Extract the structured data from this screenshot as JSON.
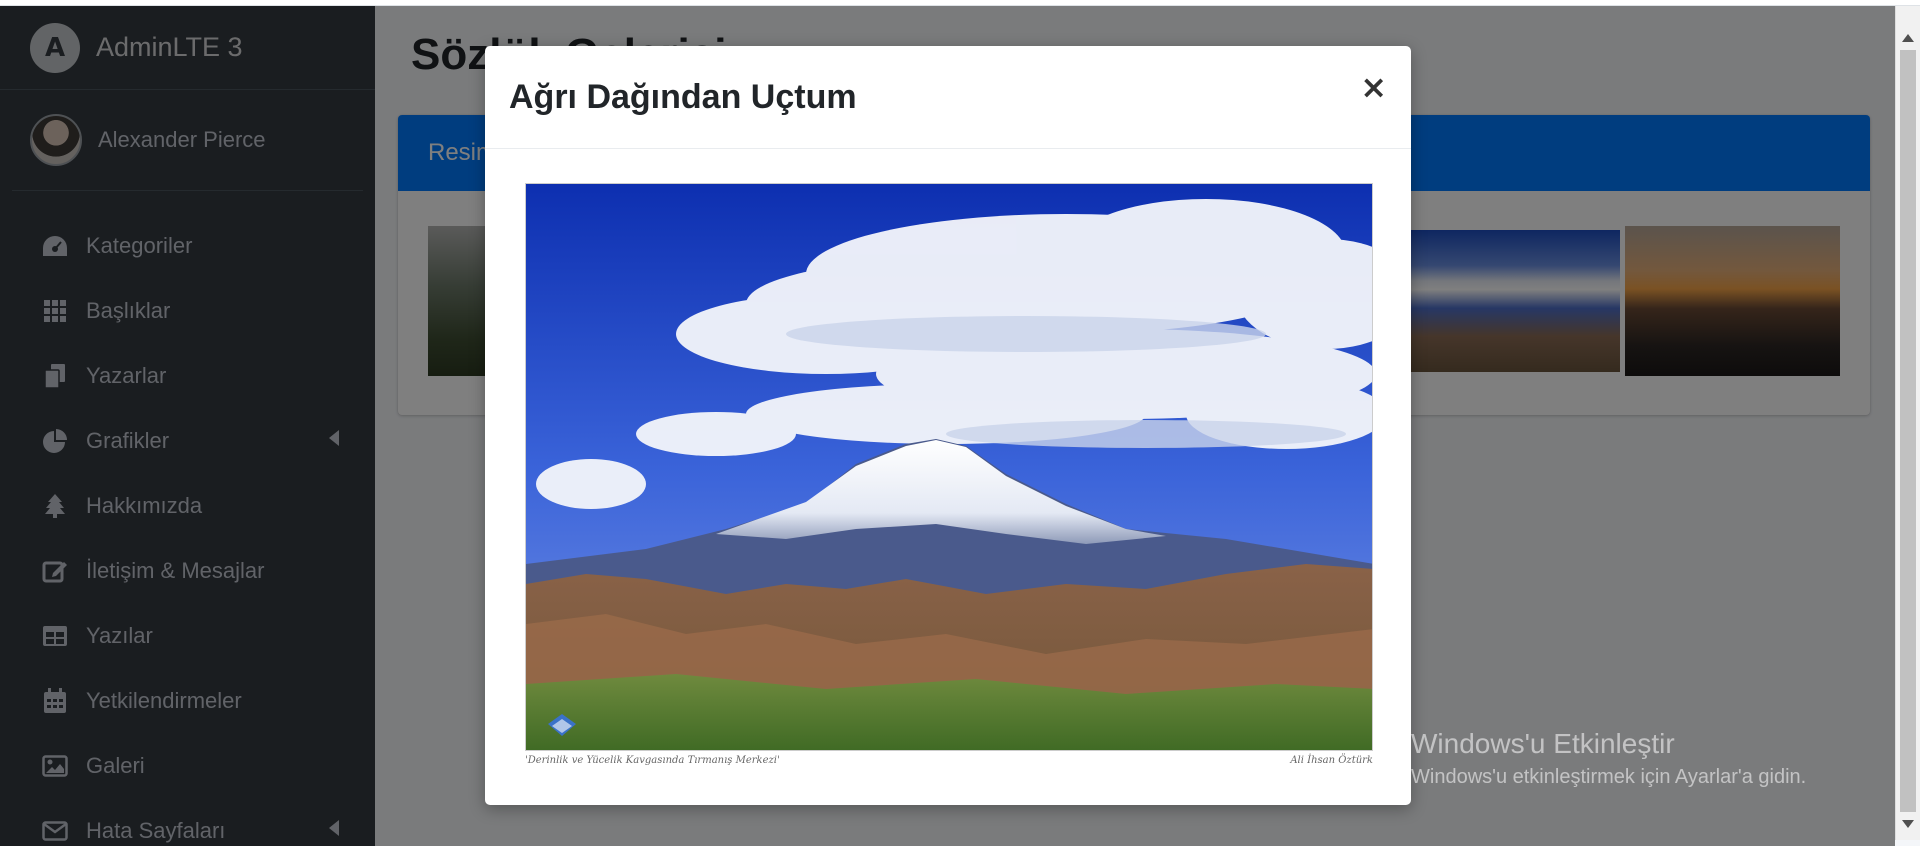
{
  "brand": {
    "name": "AdminLTE 3",
    "logo_letter": "A"
  },
  "user": {
    "name": "Alexander Pierce"
  },
  "sidebar": {
    "items": [
      {
        "label": "Kategoriler",
        "icon": "dashboard-icon"
      },
      {
        "label": "Başlıklar",
        "icon": "grid-icon"
      },
      {
        "label": "Yazarlar",
        "icon": "copy-icon"
      },
      {
        "label": "Grafikler",
        "icon": "pie-chart-icon",
        "has_submenu": true
      },
      {
        "label": "Hakkımızda",
        "icon": "tree-icon"
      },
      {
        "label": "İletişim & Mesajlar",
        "icon": "edit-icon"
      },
      {
        "label": "Yazılar",
        "icon": "table-icon"
      },
      {
        "label": "Yetkilendirmeler",
        "icon": "calendar-icon"
      },
      {
        "label": "Galeri",
        "icon": "image-icon"
      },
      {
        "label": "Hata Sayfaları",
        "icon": "envelope-icon",
        "has_submenu": true
      }
    ]
  },
  "page": {
    "title": "Sözlük Galerisi",
    "card_title": "Resimler"
  },
  "modal": {
    "title": "Ağrı Dağından Uçtum",
    "close_label": "×",
    "image_caption_left": "'Derinlik ve Yücelik Kavgasında Tırmanış Merkezi'",
    "image_caption_right": "Ali İhsan Öztürk"
  },
  "watermark": {
    "title": "Windows'u Etkinleştir",
    "subtitle": "Windows'u etkinleştirmek için Ayarlar'a gidin."
  }
}
